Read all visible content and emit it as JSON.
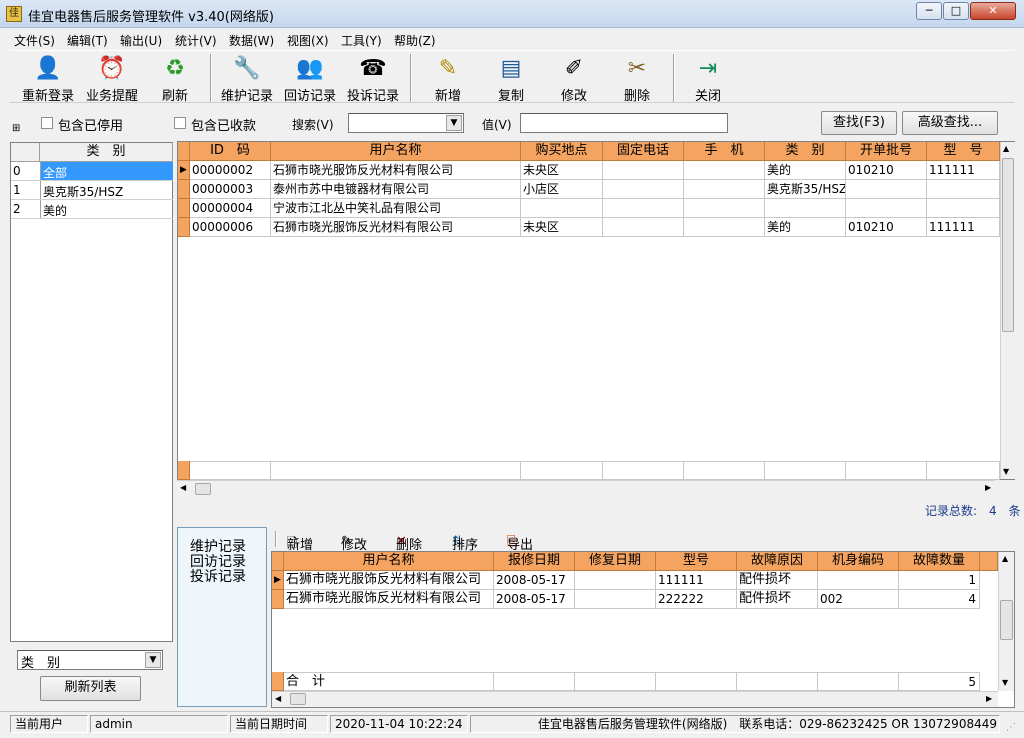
{
  "window": {
    "title": "佳宜电器售后服务管理软件 v3.40(网络版)",
    "minimize": "─",
    "maximize": "□",
    "close": "✕"
  },
  "menu": [
    "文件(S)",
    "编辑(T)",
    "输出(U)",
    "统计(V)",
    "数据(W)",
    "视图(X)",
    "工具(Y)",
    "帮助(Z)"
  ],
  "toolbar": [
    {
      "label": "重新登录",
      "icon": "relogin-icon",
      "glyph": "👤"
    },
    {
      "label": "业务提醒",
      "icon": "reminder-icon",
      "glyph": "⏰"
    },
    {
      "label": "刷新",
      "icon": "refresh-icon",
      "glyph": "♻"
    },
    {
      "label": "维护记录",
      "icon": "maintenance-icon",
      "glyph": "🔧"
    },
    {
      "label": "回访记录",
      "icon": "return-visit-icon",
      "glyph": "👥"
    },
    {
      "label": "投诉记录",
      "icon": "complaint-icon",
      "glyph": "☎"
    },
    {
      "label": "新增",
      "icon": "add-icon",
      "glyph": "✎"
    },
    {
      "label": "复制",
      "icon": "copy-icon",
      "glyph": "▤"
    },
    {
      "label": "修改",
      "icon": "edit-icon",
      "glyph": "✐"
    },
    {
      "label": "删除",
      "icon": "delete-icon",
      "glyph": "✂"
    },
    {
      "label": "关闭",
      "icon": "exit-icon",
      "glyph": "⇥"
    }
  ],
  "filters": {
    "include_disabled": "包含已停用",
    "include_paid": "包含已收款",
    "search_label": "搜索(V)",
    "search_value": "",
    "value_label": "值(V)",
    "value_input": "",
    "find_button": "查找(F3)",
    "advanced_button": "高级查找..."
  },
  "category_list": {
    "header": "类　别",
    "rows": [
      {
        "num": "0",
        "name": "全部",
        "selected": true
      },
      {
        "num": "1",
        "name": "奥克斯35/HSZ",
        "selected": false
      },
      {
        "num": "2",
        "name": "美的",
        "selected": false
      }
    ],
    "select_value": "类　别",
    "refresh_button": "刷新列表"
  },
  "main_grid": {
    "columns": [
      "ID　码",
      "用户名称",
      "购买地点",
      "固定电话",
      "手　机",
      "类　别",
      "开单批号",
      "型　号"
    ],
    "rows": [
      [
        "00000002",
        "石狮市晓光服饰反光材料有限公司",
        "未央区",
        "",
        "",
        "美的",
        "010210",
        "111111"
      ],
      [
        "00000003",
        "泰州市苏中电镀器材有限公司",
        "小店区",
        "",
        "",
        "奥克斯35/HSZ",
        "",
        ""
      ],
      [
        "00000004",
        "宁波市江北丛中笑礼品有限公司",
        "",
        "",
        "",
        "",
        "",
        ""
      ],
      [
        "00000006",
        "石狮市晓光服饰反光材料有限公司",
        "未央区",
        "",
        "",
        "美的",
        "010210",
        "111111"
      ]
    ],
    "record_count": "记录总数:　4　条"
  },
  "record_tabs": [
    "维护记录",
    "回访记录",
    "投诉记录"
  ],
  "sub_toolbar": [
    {
      "label": "新增",
      "icon": "new-doc-icon",
      "glyph": "🗋"
    },
    {
      "label": "修改",
      "icon": "edit-icon",
      "glyph": "✎"
    },
    {
      "label": "删除",
      "icon": "delete-x-icon",
      "glyph": "✕"
    },
    {
      "label": "排序",
      "icon": "sort-icon",
      "glyph": "⇅"
    },
    {
      "label": "导出",
      "icon": "export-icon",
      "glyph": "⎘"
    }
  ],
  "sub_grid": {
    "columns": [
      "用户名称",
      "报修日期",
      "修复日期",
      "型号",
      "故障原因",
      "机身编码",
      "故障数量"
    ],
    "rows": [
      [
        "石狮市晓光服饰反光材料有限公司",
        "2008-05-17",
        "",
        "111111",
        "配件损坏",
        "",
        "1"
      ],
      [
        "石狮市晓光服饰反光材料有限公司",
        "2008-05-17",
        "",
        "222222",
        "配件损坏",
        "002",
        "4"
      ]
    ],
    "total_label": "合　计",
    "total_value": "5"
  },
  "status": {
    "user_label": "当前用户",
    "user": "admin",
    "date_label": "当前日期时间",
    "datetime": "2020-11-04 10:22:24",
    "info": "佳宜电器售后服务管理软件(网络版)　联系电话：029-86232425 OR 13072908449"
  },
  "colors": {
    "header": "#f4a460",
    "selection": "#3399ff",
    "tab_panel": "#eef6fb"
  }
}
